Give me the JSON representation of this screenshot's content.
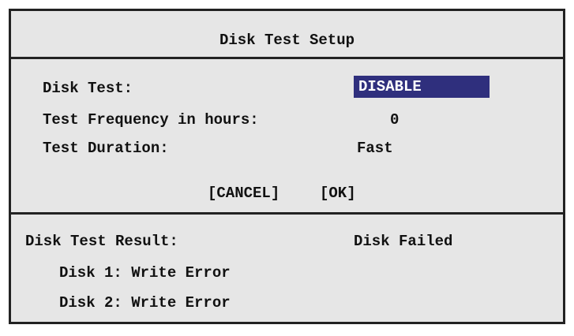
{
  "dialog": {
    "title": "Disk Test Setup",
    "fields": [
      {
        "label": "Disk Test:",
        "value": "DISABLE"
      },
      {
        "label": "Test Frequency in hours:",
        "value": "0"
      },
      {
        "label": "Test Duration:",
        "value": "Fast"
      }
    ],
    "buttons": {
      "cancel": "[CANCEL]",
      "ok": "[OK]"
    }
  },
  "result": {
    "label": "Disk Test Result:",
    "status": "Disk Failed",
    "disks": [
      "Disk 1: Write Error",
      "Disk 2: Write Error"
    ]
  },
  "colors": {
    "highlight_bg": "#2f2f7d",
    "highlight_fg": "#ffffff",
    "panel_bg": "#e6e6e6",
    "border": "#222222"
  }
}
